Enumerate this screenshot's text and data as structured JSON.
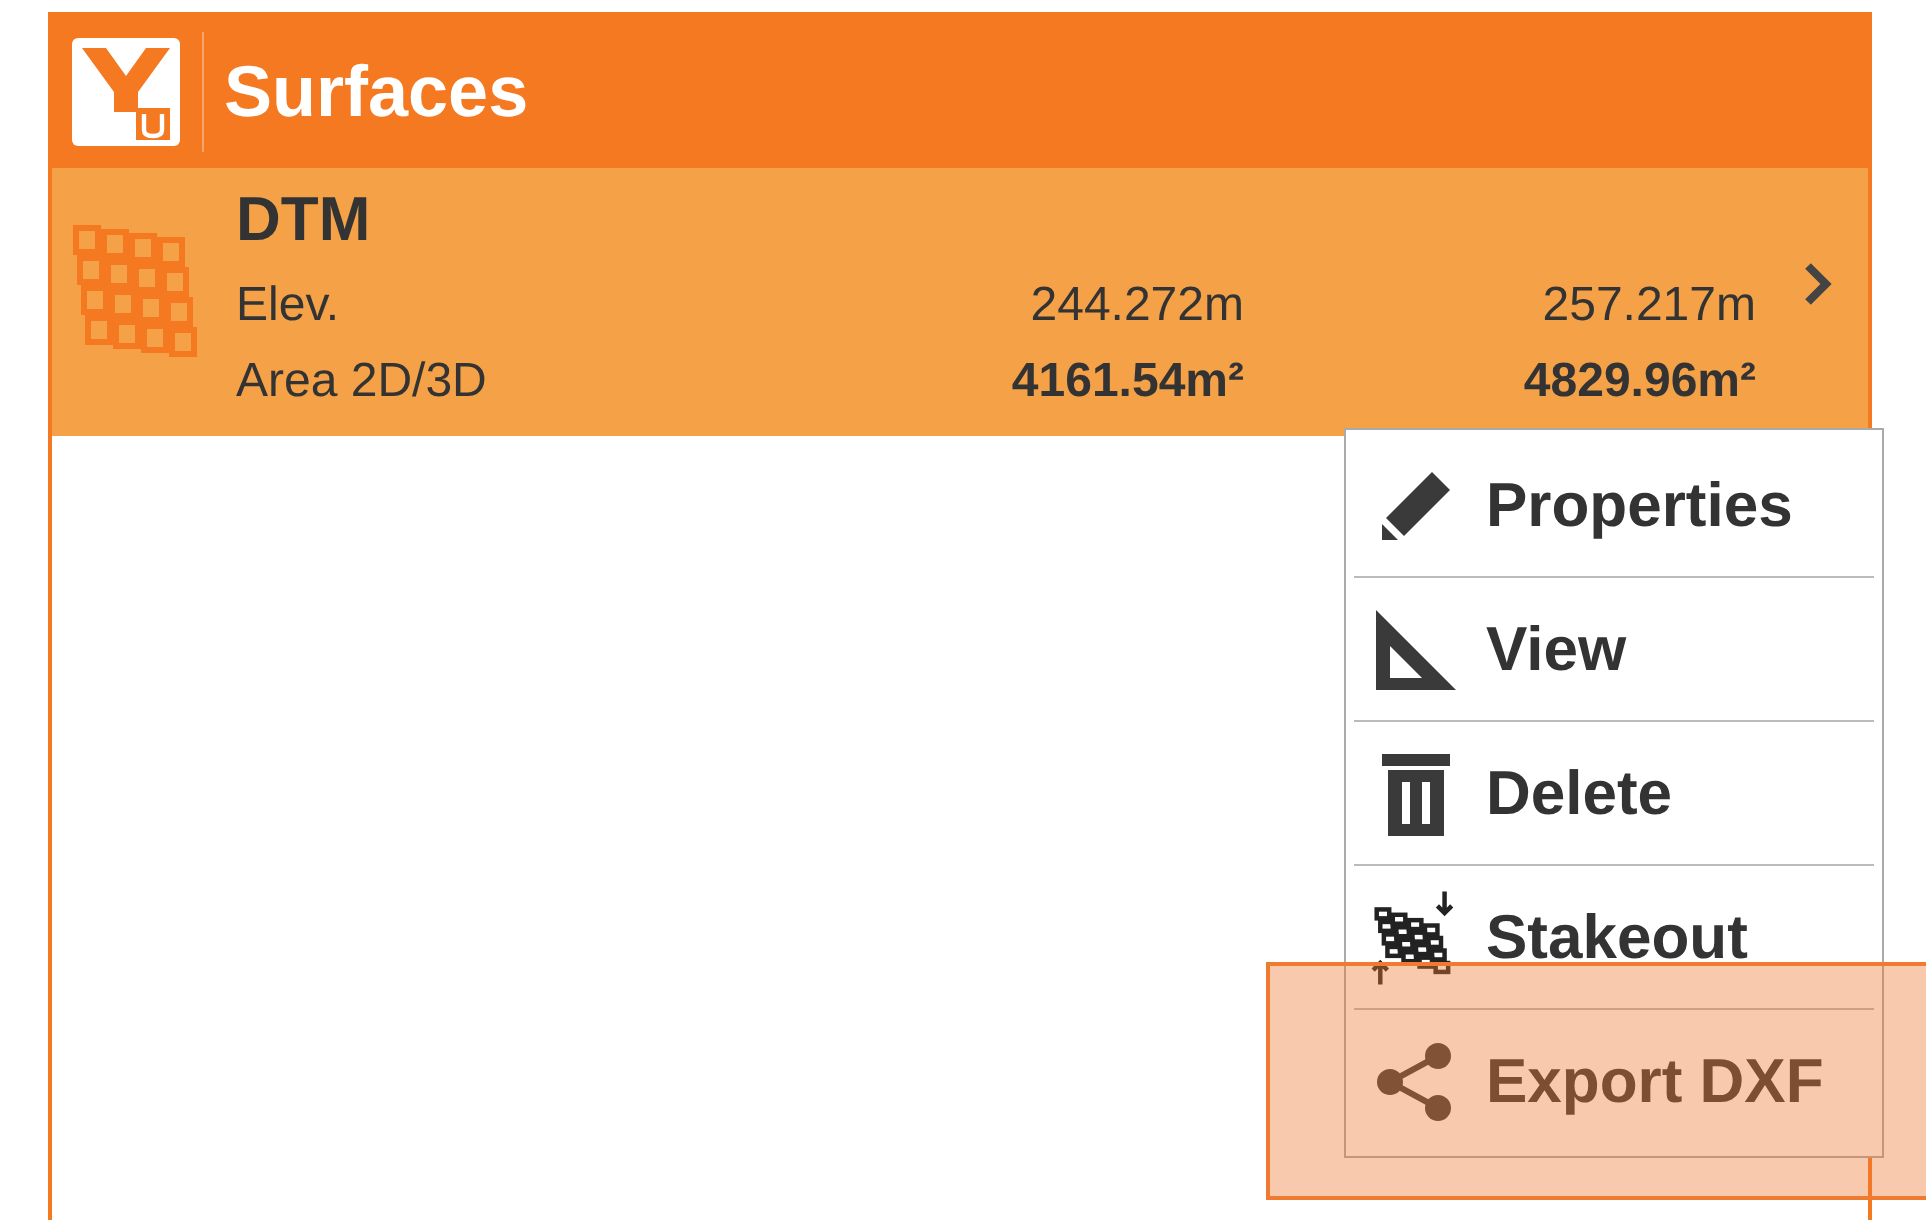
{
  "header": {
    "title": "Surfaces"
  },
  "surfaces": [
    {
      "name": "DTM",
      "selected": true,
      "elev_label": "Elev.",
      "elev_min": "244.272m",
      "elev_max": "257.217m",
      "area_label": "Area 2D/3D",
      "area_2d": "4161.54m²",
      "area_3d": "4829.96m²"
    }
  ],
  "context_menu": {
    "items": [
      {
        "label": "Properties",
        "kind": "properties",
        "highlighted": false
      },
      {
        "label": "View",
        "kind": "view",
        "highlighted": false
      },
      {
        "label": "Delete",
        "kind": "delete",
        "highlighted": false
      },
      {
        "label": "Stakeout",
        "kind": "stakeout",
        "highlighted": false
      },
      {
        "label": "Export DXF",
        "kind": "export",
        "highlighted": true
      }
    ]
  }
}
